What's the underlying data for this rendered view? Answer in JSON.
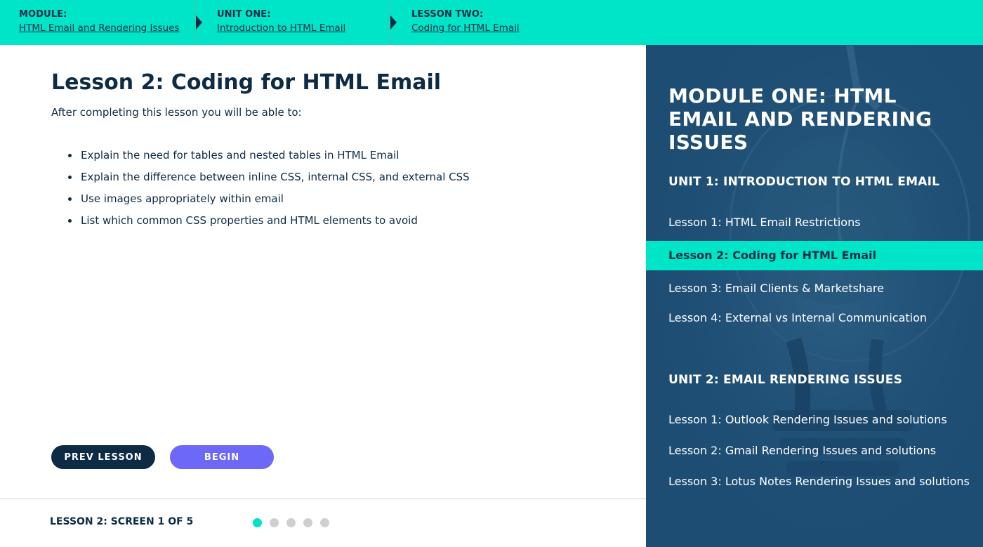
{
  "breadcrumb": {
    "module": {
      "label": "MODULE:",
      "link": "HTML Email and Rendering Issues"
    },
    "unit": {
      "label": "UNIT ONE:",
      "link": "Introduction to HTML Email"
    },
    "lesson": {
      "label": "LESSON TWO:",
      "link": "Coding for HTML Email"
    }
  },
  "main": {
    "title": "Lesson 2: Coding for HTML Email",
    "intro": "After completing this lesson you will be able to:",
    "objectives": [
      "Explain the need for tables and nested tables in HTML Email",
      "Explain the difference between inline CSS, internal CSS, and external CSS",
      "Use images appropriately within email",
      "List which common CSS properties and HTML elements to avoid"
    ],
    "prev_label": "PREV LESSON",
    "begin_label": "BEGIN"
  },
  "footer": {
    "screen_label": "LESSON 2: SCREEN 1 OF 5",
    "current_screen": 1,
    "total_screens": 5
  },
  "sidebar": {
    "module_title": "MODULE ONE: HTML EMAIL AND RENDERING ISSUES",
    "units": [
      {
        "title": "UNIT 1: INTRODUCTION TO HTML EMAIL",
        "lessons": [
          "Lesson 1: HTML Email Restrictions",
          "Lesson 2: Coding for HTML Email",
          "Lesson 3: Email Clients & Marketshare",
          "Lesson 4: External vs Internal Communication"
        ]
      },
      {
        "title": "UNIT 2: EMAIL RENDERING ISSUES",
        "lessons": [
          "Lesson 1: Outlook Rendering Issues and solutions",
          "Lesson 2: Gmail Rendering Issues and solutions",
          "Lesson 3: Lotus Notes Rendering Issues and solutions"
        ]
      }
    ],
    "active_lesson": "Lesson 2: Coding for HTML Email"
  },
  "colors": {
    "accent": "#00e5c8",
    "navy": "#0d2b45",
    "begin_button": "#6d68f7",
    "sidebar_bg": "#1d4d73",
    "dot_inactive": "#cfcfcf"
  }
}
